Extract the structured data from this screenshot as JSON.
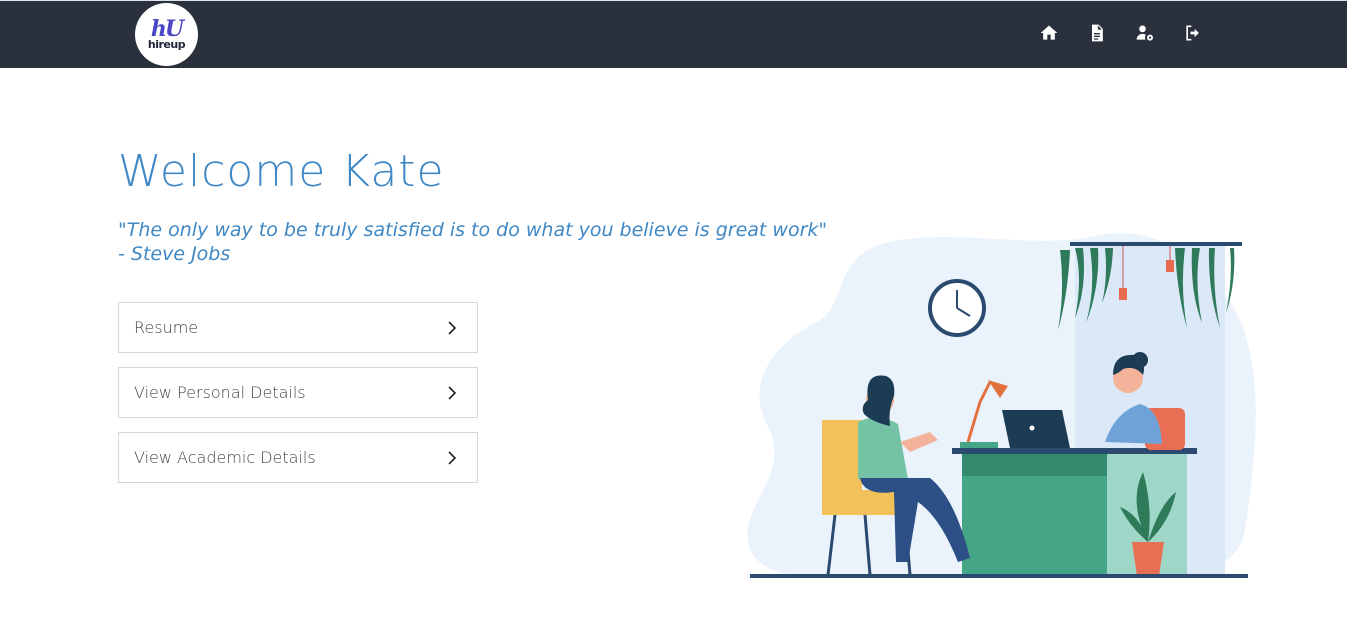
{
  "brand": {
    "mark": "hU",
    "name": "hireup"
  },
  "nav": {
    "icons": [
      "home-icon",
      "document-icon",
      "user-settings-icon",
      "logout-icon"
    ]
  },
  "main": {
    "welcome": "Welcome Kate",
    "quote_line1": "\"The only way to be truly satisfied is to do what you believe is great work\"",
    "quote_line2": "- Steve Jobs"
  },
  "menu": {
    "items": [
      {
        "label": "Resume"
      },
      {
        "label": "View Personal Details"
      },
      {
        "label": "View Academic Details"
      }
    ]
  },
  "colors": {
    "navbar": "#2a303c",
    "accent": "#3f88c5",
    "logo_mark": "#4a45c4"
  }
}
